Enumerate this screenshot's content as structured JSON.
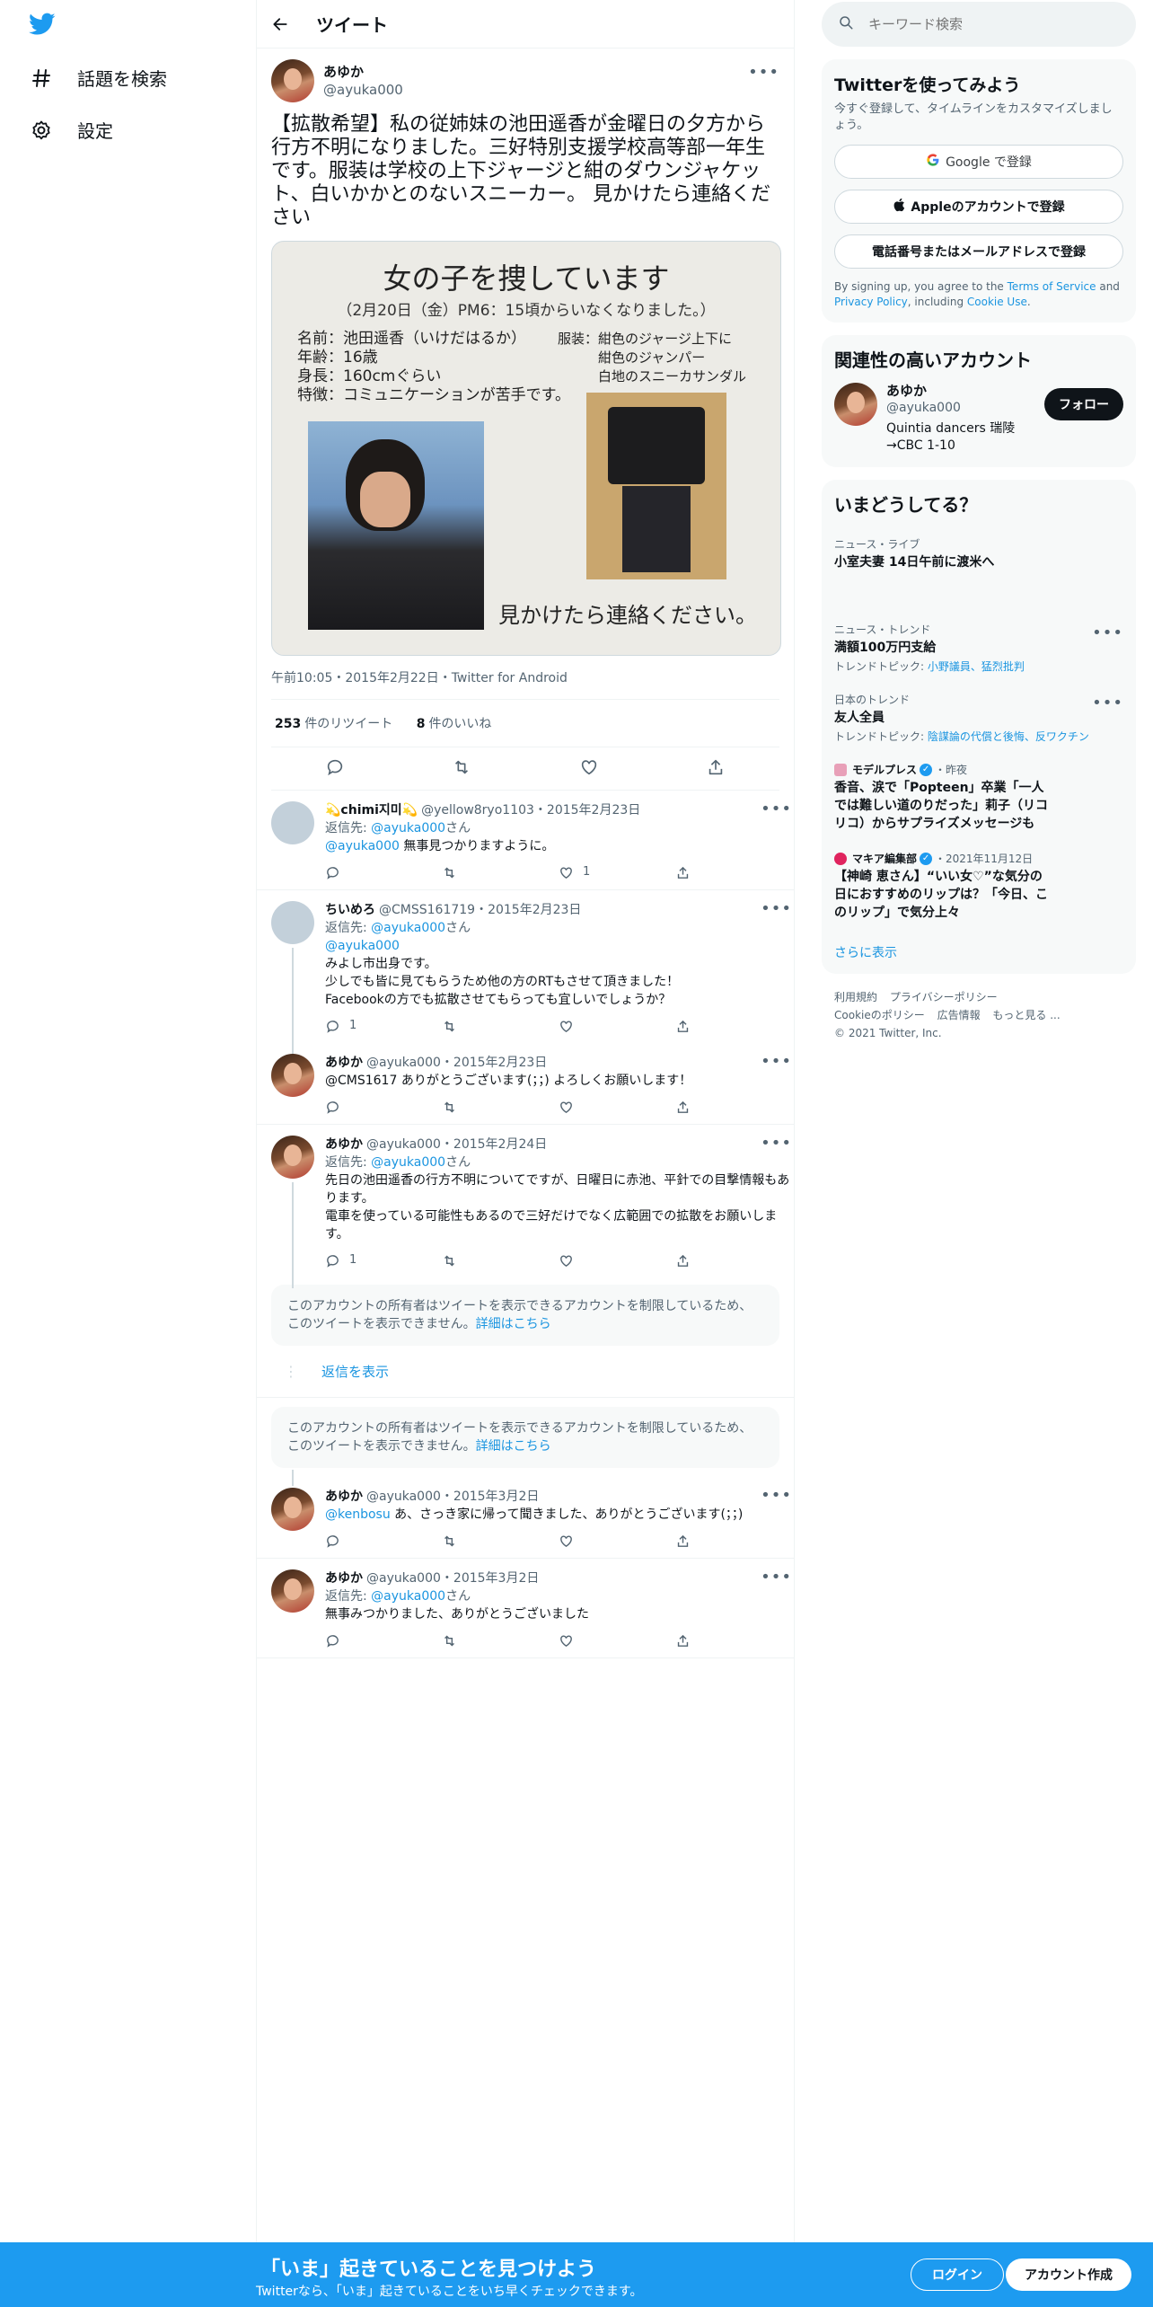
{
  "nav": {
    "explore_label": "話題を検索",
    "settings_label": "設定"
  },
  "header": {
    "title": "ツイート"
  },
  "main_tweet": {
    "name": "あゆか",
    "handle": "@ayuka000",
    "text": "【拡散希望】私の従姉妹の池田遥香が金曜日の夕方から行方不明になりました。三好特別支援学校高等部一年生です。服装は学校の上下ジャージと紺のダウンジャケット、白いかかとのないスニーカー。 見かけたら連絡ください",
    "image": {
      "title": "女の子を捜しています",
      "subtitle": "（2月20日（金）PM6：15頃からいなくなりました。）",
      "info_left": "名前：池田遥香（いけだはるか）\n年齢：16歳\n身長：160cmぐらい\n特徴：コミュニケーションが苦手です。",
      "info_right": "服装：紺色のジャージ上下に\n　　　紺色のジャンパー\n　　　白地のスニーカサンダル",
      "footer": "見かけたら連絡ください。"
    },
    "meta": "午前10:05・2015年2月22日・Twitter for Android",
    "retweets_count": "253",
    "retweets_label": "件のリツイート",
    "likes_count": "8",
    "likes_label": "件のいいね"
  },
  "replies": [
    {
      "name": "💫chimi지미💫",
      "handle": "@yellow8ryo1103",
      "date": "・2015年2月23日",
      "reply_to_label": "返信先:",
      "reply_to": "@ayuka000",
      "reply_to_suffix": "さん",
      "mention": "@ayuka000",
      "text": " 無事見つかりますように。",
      "replies": "",
      "likes": "1"
    },
    {
      "name": "ちいめろ",
      "handle": "@CMSS161719",
      "date": "・2015年2月23日",
      "reply_to_label": "返信先:",
      "reply_to": "@ayuka000",
      "reply_to_suffix": "さん",
      "mention": "@ayuka000",
      "line1": "みよし市出身です。",
      "line2": "少しでも皆に見てもらうため他の方のRTもさせて頂きました！",
      "line3": "Facebookの方でも拡散させてもらっても宜しいでしょうか？",
      "replies": "1"
    },
    {
      "name": "あゆか",
      "handle": "@ayuka000",
      "date": "・2015年2月23日",
      "text": "@CMS1617 ありがとうございます(；；) よろしくお願いします！"
    },
    {
      "name": "あゆか",
      "handle": "@ayuka000",
      "date": "・2015年2月24日",
      "reply_to_label": "返信先:",
      "reply_to": "@ayuka000",
      "reply_to_suffix": "さん",
      "line1": "先日の池田遥香の行方不明についてですが、日曜日に赤池、平針での目撃情報もあります。",
      "line2": "電車を使っている可能性もあるので三好だけでなく広範囲での拡散をお願いします。",
      "replies": "1"
    },
    {
      "name": "あゆか",
      "handle": "@ayuka000",
      "date": "・2015年3月2日",
      "mention": "@kenbosu",
      "text": " あ、さっき家に帰って聞きました、ありがとうございます(；；)"
    },
    {
      "name": "あゆか",
      "handle": "@ayuka000",
      "date": "・2015年3月2日",
      "reply_to_label": "返信先:",
      "reply_to": "@ayuka000",
      "reply_to_suffix": "さん",
      "text": "無事みつかりました、ありがとうございました"
    }
  ],
  "notice": {
    "text": "このアカウントの所有者はツイートを表示できるアカウントを制限しているため、このツイートを表示できません。",
    "link": "詳細はこちら"
  },
  "show_replies": "返信を表示",
  "search": {
    "placeholder": "キーワード検索"
  },
  "signup": {
    "title": "Twitterを使ってみよう",
    "subtitle": "今すぐ登録して、タイムラインをカスタマイズしましょう。",
    "google": "Google で登録",
    "apple": "Appleのアカウントで登録",
    "phone": "電話番号またはメールアドレスで登録",
    "legal_prefix": "By signing up, you agree to the ",
    "terms": "Terms of Service",
    "and": " and ",
    "privacy": "Privacy Policy",
    "including": ", including ",
    "cookie": "Cookie Use",
    "period": "."
  },
  "related": {
    "title": "関連性の高いアカウント",
    "name": "あゆか",
    "handle": "@ayuka000",
    "bio": "Quintia dancers 瑞陵→CBC 1-10",
    "follow": "フォロー"
  },
  "trends": {
    "title": "いまどうしてる？",
    "items": [
      {
        "category": "ニュース・ライブ",
        "title": "小室夫妻 14日午前に渡米へ",
        "topics_label": "",
        "topics": ""
      },
      {
        "category": "ニュース・トレンド",
        "title": "満額100万円支給",
        "topics_label": "トレンドトピック: ",
        "topics": "小野議員、猛烈批判"
      },
      {
        "category": "日本のトレンド",
        "title": "友人全員",
        "topics_label": "トレンドトピック: ",
        "topics": "陰謀論の代償と後悔、反ワクチン"
      },
      {
        "category": "モデルプレス",
        "category_suffix": "・昨夜",
        "title": "香音、涙で「Popteen」卒業「一人では難しい道のりだった」莉子（リコリコ）からサプライズメッセージも"
      },
      {
        "category": "マキア編集部",
        "category_suffix": "・2021年11月12日",
        "title": "【神崎 恵さん】“いい女♡”な気分の日におすすめのリップは？「今日、このリップ」で気分上々"
      }
    ],
    "more": "さらに表示"
  },
  "footer": {
    "links": [
      "利用規約",
      "プライバシーポリシー",
      "Cookieのポリシー",
      "広告情報",
      "もっと見る ..."
    ],
    "copyright": "© 2021 Twitter, Inc."
  },
  "banner": {
    "title": "「いま」起きていることを見つけよう",
    "subtitle": "Twitterなら、「いま」起きていることをいち早くチェックできます。",
    "login": "ログイン",
    "signup": "アカウント作成"
  },
  "colors": {
    "accent": "#1d9bf0",
    "link": "#1b95e0",
    "text": "#0f1419",
    "muted": "#536471"
  }
}
